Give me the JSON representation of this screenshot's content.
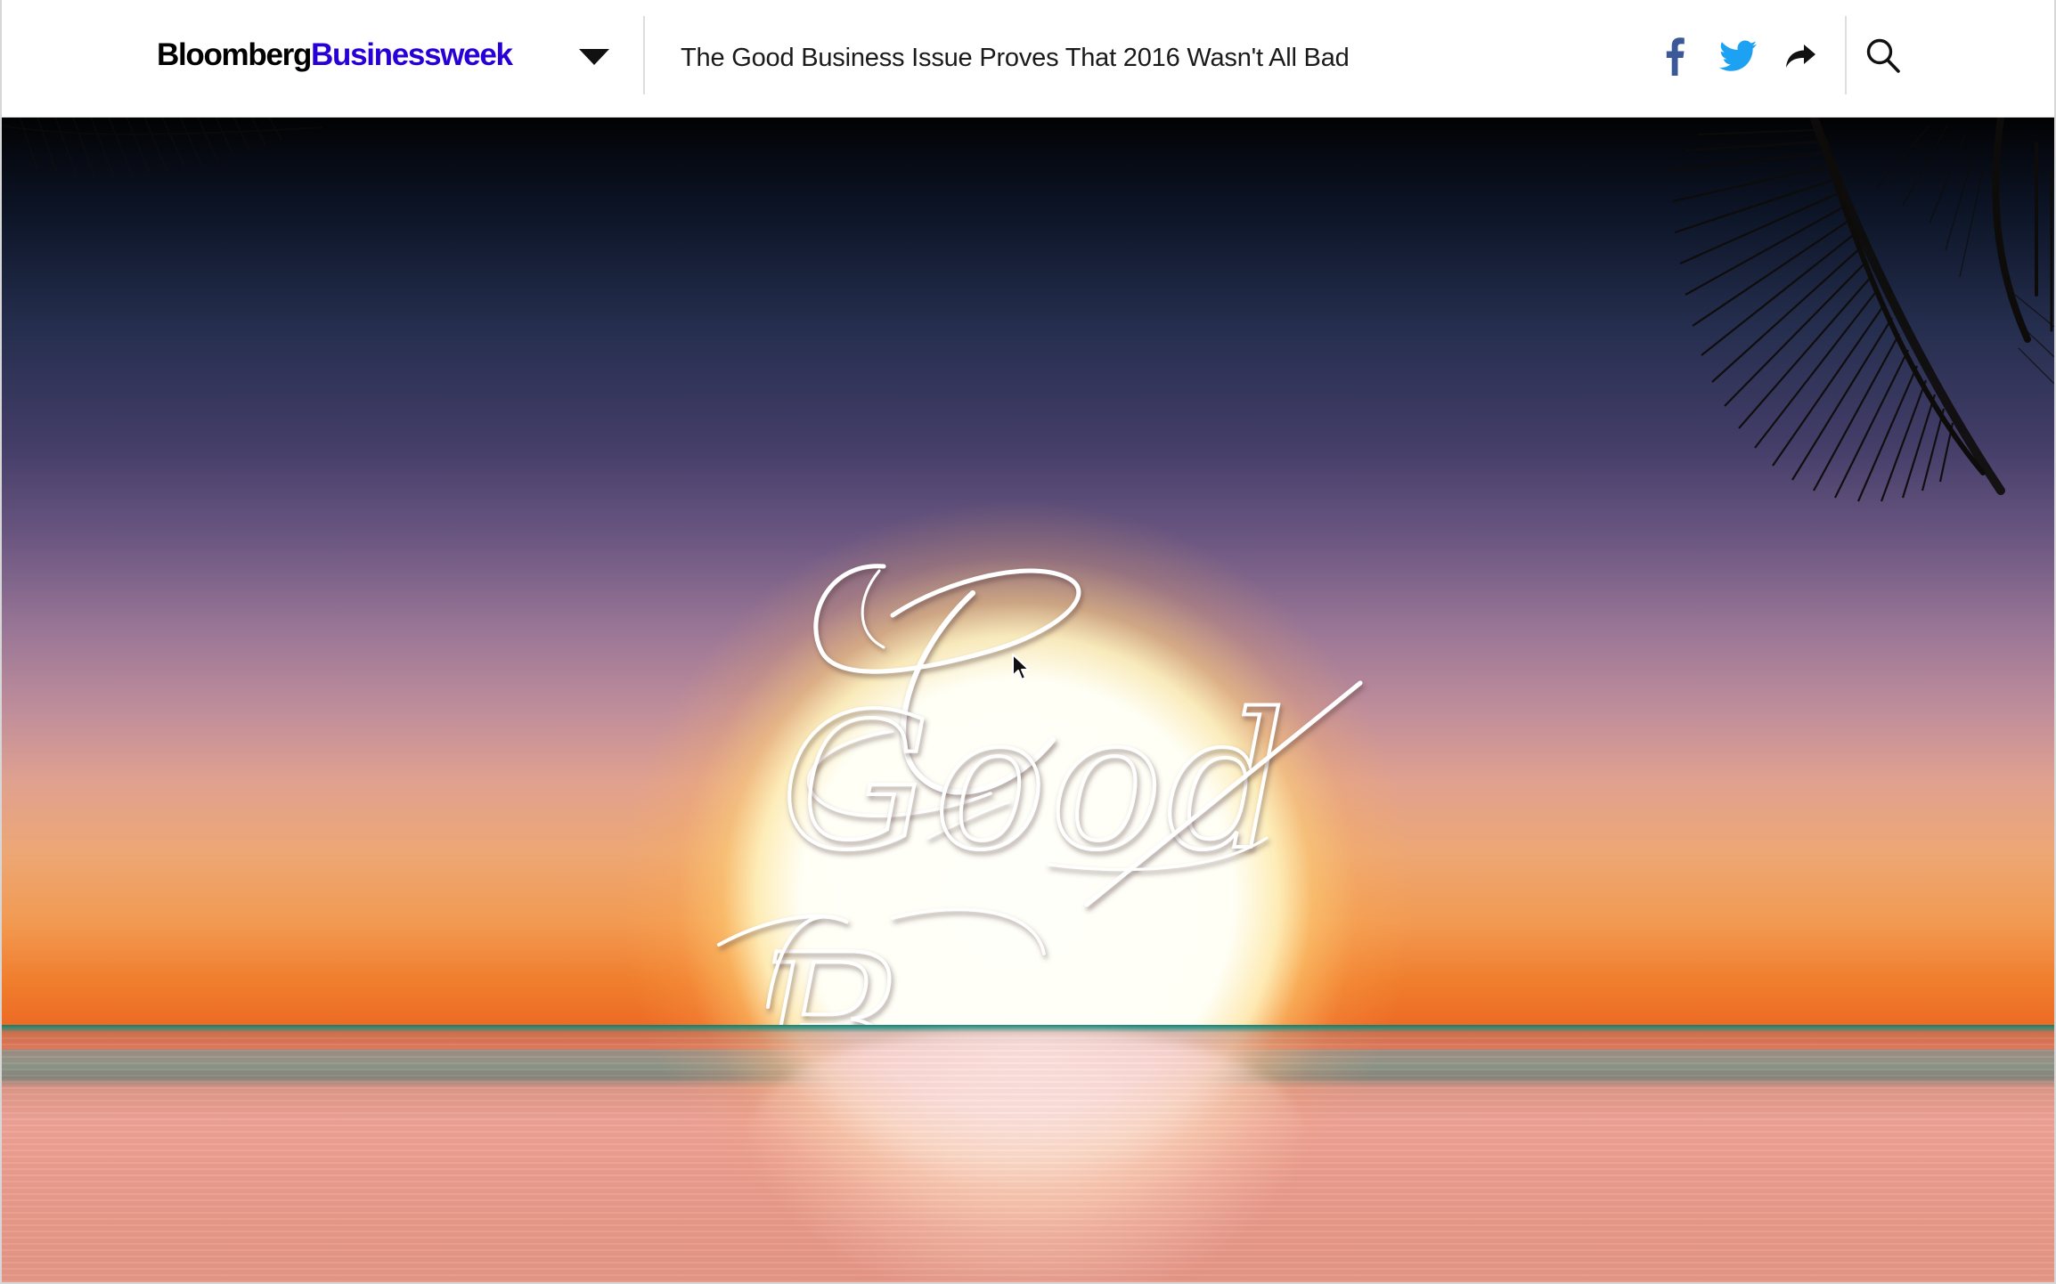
{
  "brand": {
    "part1": "Bloomberg",
    "part2": "Businessweek",
    "brand_color": "#2800d7"
  },
  "header": {
    "headline": "The Good Business Issue Proves That 2016 Wasn't All Bad",
    "menu_icon": "chevron-down-icon",
    "share_icons": [
      "facebook-icon",
      "twitter-icon",
      "share-arrow-icon"
    ],
    "search_icon": "search-icon",
    "facebook_color": "#3b5998",
    "twitter_color": "#1da1f2"
  },
  "hero": {
    "title_line1": "Good",
    "title_line2": "B"
  }
}
